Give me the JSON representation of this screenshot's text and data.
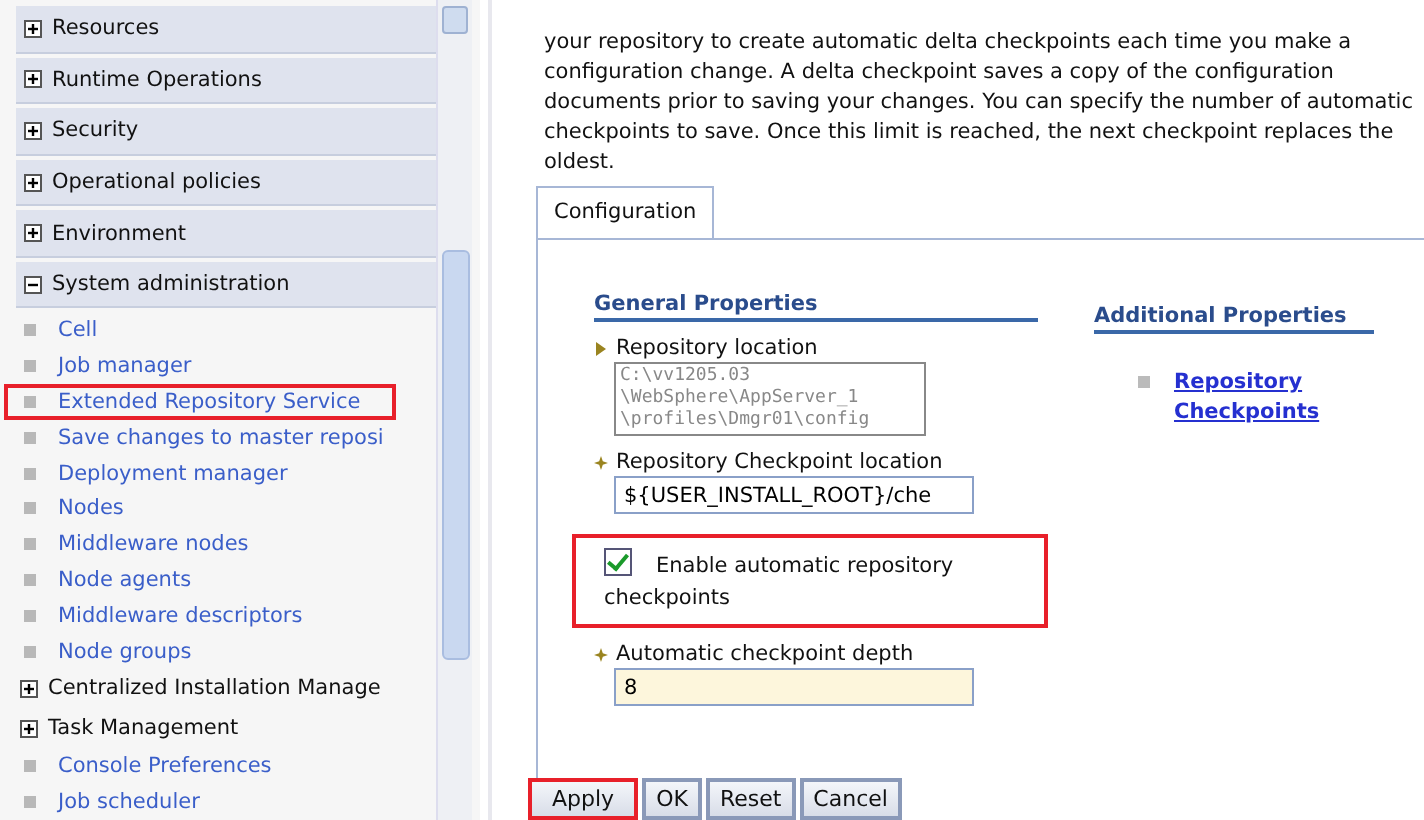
{
  "sidebar": {
    "items": [
      {
        "kind": "category",
        "label": "Resources",
        "expanded": false
      },
      {
        "kind": "category",
        "label": "Runtime Operations",
        "expanded": false
      },
      {
        "kind": "category",
        "label": "Security",
        "expanded": false
      },
      {
        "kind": "category",
        "label": "Operational policies",
        "expanded": false
      },
      {
        "kind": "category",
        "label": "Environment",
        "expanded": false
      },
      {
        "kind": "category",
        "label": "System administration",
        "expanded": true,
        "children": [
          {
            "kind": "link",
            "label": "Cell",
            "highlighted": false
          },
          {
            "kind": "link",
            "label": "Job manager",
            "highlighted": false
          },
          {
            "kind": "link",
            "label": "Extended Repository Service",
            "highlighted": true
          },
          {
            "kind": "link",
            "label": "Save changes to master reposi",
            "highlighted": false
          },
          {
            "kind": "link",
            "label": "Deployment manager",
            "highlighted": false
          },
          {
            "kind": "link",
            "label": "Nodes",
            "highlighted": false
          },
          {
            "kind": "link",
            "label": "Middleware nodes",
            "highlighted": false
          },
          {
            "kind": "link",
            "label": "Node agents",
            "highlighted": false
          },
          {
            "kind": "link",
            "label": "Middleware descriptors",
            "highlighted": false
          },
          {
            "kind": "link",
            "label": "Node groups",
            "highlighted": false
          },
          {
            "kind": "category",
            "label": "Centralized Installation Manage",
            "expanded": false
          },
          {
            "kind": "category",
            "label": "Task Management",
            "expanded": false
          },
          {
            "kind": "link",
            "label": "Console Preferences",
            "highlighted": false
          },
          {
            "kind": "link",
            "label": "Job scheduler",
            "highlighted": false
          }
        ]
      }
    ]
  },
  "content": {
    "description": "your repository to create automatic delta checkpoints each time you make a configuration change. A delta checkpoint saves a copy of the configuration documents prior to saving your changes. You can specify the number of automatic checkpoints to save. Once this limit is reached, the next checkpoint replaces the oldest.",
    "tabs": [
      {
        "label": "Configuration",
        "selected": true
      }
    ],
    "general_properties": {
      "title": "General Properties",
      "fields": [
        {
          "kind": "readonly",
          "label": "Repository location",
          "required": false,
          "lines": [
            "C:\\vv1205.03",
            "\\WebSphere\\AppServer_1",
            "\\profiles\\Dmgr01\\config"
          ]
        },
        {
          "kind": "text",
          "label": "Repository Checkpoint location",
          "required": true,
          "value": "${USER_INSTALL_ROOT}/che"
        },
        {
          "kind": "checkbox",
          "label": "Enable automatic repository checkpoints",
          "checked": true,
          "highlighted": true
        },
        {
          "kind": "text",
          "label": "Automatic checkpoint depth",
          "required": true,
          "value": "8"
        }
      ]
    },
    "additional_properties": {
      "title": "Additional Properties",
      "links": [
        "Repository Checkpoints"
      ]
    },
    "buttons": [
      {
        "label": "Apply",
        "highlighted": true
      },
      {
        "label": "OK",
        "highlighted": false
      },
      {
        "label": "Reset",
        "highlighted": false
      },
      {
        "label": "Cancel",
        "highlighted": false
      }
    ]
  }
}
